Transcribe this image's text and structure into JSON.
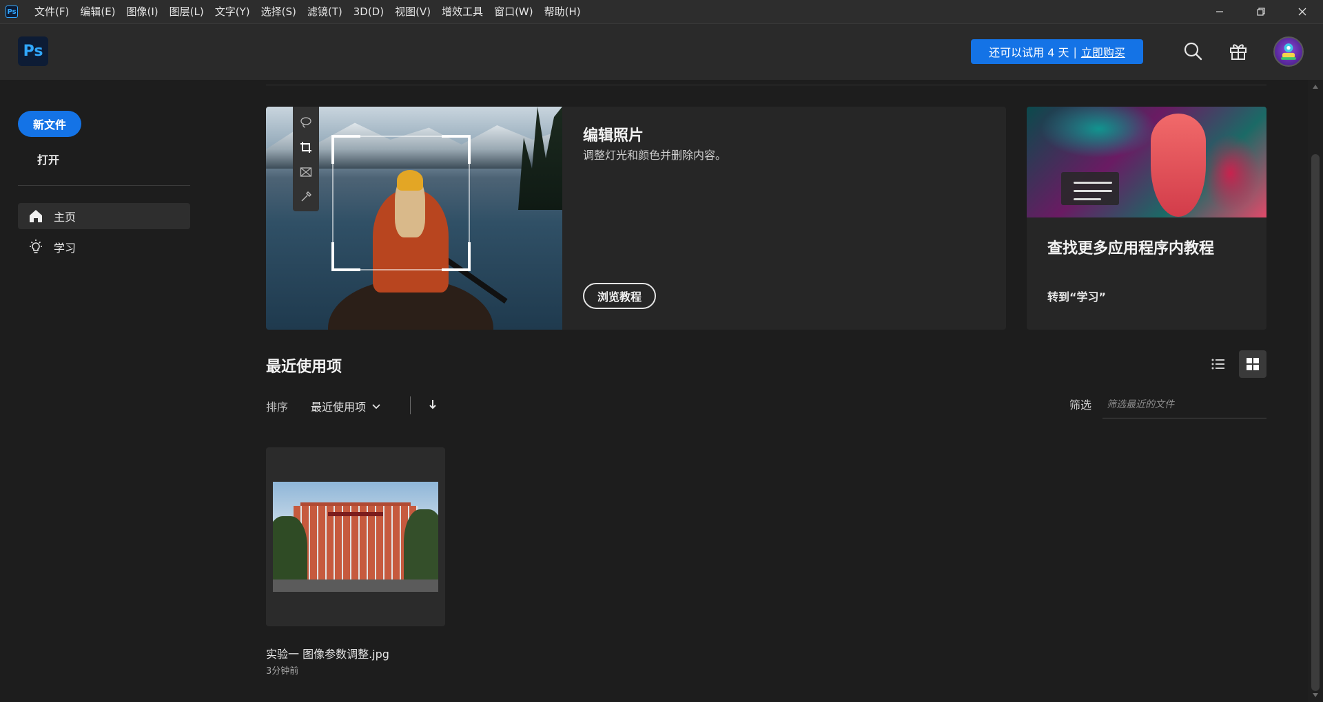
{
  "menu": {
    "app_icon": "Ps",
    "items": [
      "文件(F)",
      "编辑(E)",
      "图像(I)",
      "图层(L)",
      "文字(Y)",
      "选择(S)",
      "滤镜(T)",
      "3D(D)",
      "视图(V)",
      "增效工具",
      "窗口(W)",
      "帮助(H)"
    ]
  },
  "header": {
    "logo": "Ps",
    "trial_text": "还可以试用 4 天",
    "separator": "|",
    "buy_link": "立即购买"
  },
  "sidebar": {
    "new_file": "新文件",
    "open": "打开",
    "nav": [
      {
        "label": "主页",
        "icon": "home-icon",
        "active": true
      },
      {
        "label": "学习",
        "icon": "lightbulb-icon",
        "active": false
      }
    ]
  },
  "hero": {
    "title": "编辑照片",
    "description": "调整灯光和颜色并删除内容。",
    "button": "浏览教程",
    "tools": [
      "lasso-icon",
      "crop-icon",
      "frame-icon",
      "eyedropper-icon"
    ]
  },
  "side_card": {
    "title": "查找更多应用程序内教程",
    "link": "转到“学习”"
  },
  "recent": {
    "title": "最近使用项",
    "sort_label": "排序",
    "sort_value": "最近使用项",
    "filter_label": "筛选",
    "filter_placeholder": "筛选最近的文件",
    "files": [
      {
        "name": "实验一 图像参数调整.jpg",
        "time": "3分钟前"
      }
    ]
  },
  "colors": {
    "accent": "#1473e6",
    "ps_blue": "#31a8ff",
    "background": "#1d1d1d",
    "card": "#262626"
  }
}
